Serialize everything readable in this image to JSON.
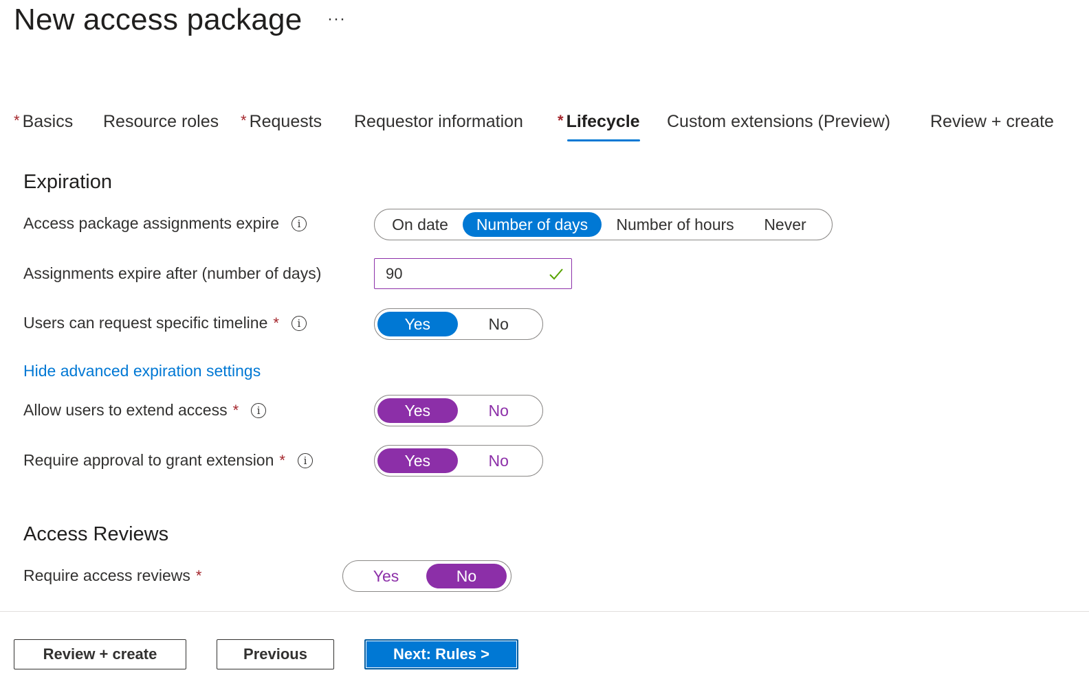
{
  "header": {
    "title": "New access package",
    "more_label": "···"
  },
  "tabs": [
    {
      "label": "Basics",
      "required": true,
      "active": false
    },
    {
      "label": "Resource roles",
      "required": false,
      "active": false
    },
    {
      "label": "Requests",
      "required": true,
      "active": false
    },
    {
      "label": "Requestor information",
      "required": false,
      "active": false
    },
    {
      "label": "Lifecycle",
      "required": true,
      "active": true
    },
    {
      "label": "Custom extensions (Preview)",
      "required": false,
      "active": false
    },
    {
      "label": "Review + create",
      "required": false,
      "active": false
    }
  ],
  "required_marker": "*",
  "expiration": {
    "title": "Expiration",
    "assignments_expire": {
      "label": "Access package assignments expire",
      "options": [
        "On date",
        "Number of days",
        "Number of hours",
        "Never"
      ],
      "selected": "Number of days"
    },
    "expire_after": {
      "label": "Assignments expire after (number of days)",
      "value": "90"
    },
    "specific_timeline": {
      "label": "Users can request specific timeline",
      "options": [
        "Yes",
        "No"
      ],
      "selected": "Yes"
    },
    "advanced_link": "Hide advanced expiration settings",
    "extend_access": {
      "label": "Allow users to extend access",
      "options": [
        "Yes",
        "No"
      ],
      "selected": "Yes"
    },
    "approval_extension": {
      "label": "Require approval to grant extension",
      "options": [
        "Yes",
        "No"
      ],
      "selected": "Yes"
    }
  },
  "access_reviews": {
    "title": "Access Reviews",
    "require_reviews": {
      "label": "Require access reviews",
      "options": [
        "Yes",
        "No"
      ],
      "selected": "No"
    }
  },
  "footer": {
    "review_create": "Review + create",
    "previous": "Previous",
    "next": "Next: Rules >"
  },
  "colors": {
    "accent_blue": "#0078d4",
    "accent_purple": "#8c2fa8",
    "required_red": "#a4262c",
    "valid_green": "#57a300"
  }
}
